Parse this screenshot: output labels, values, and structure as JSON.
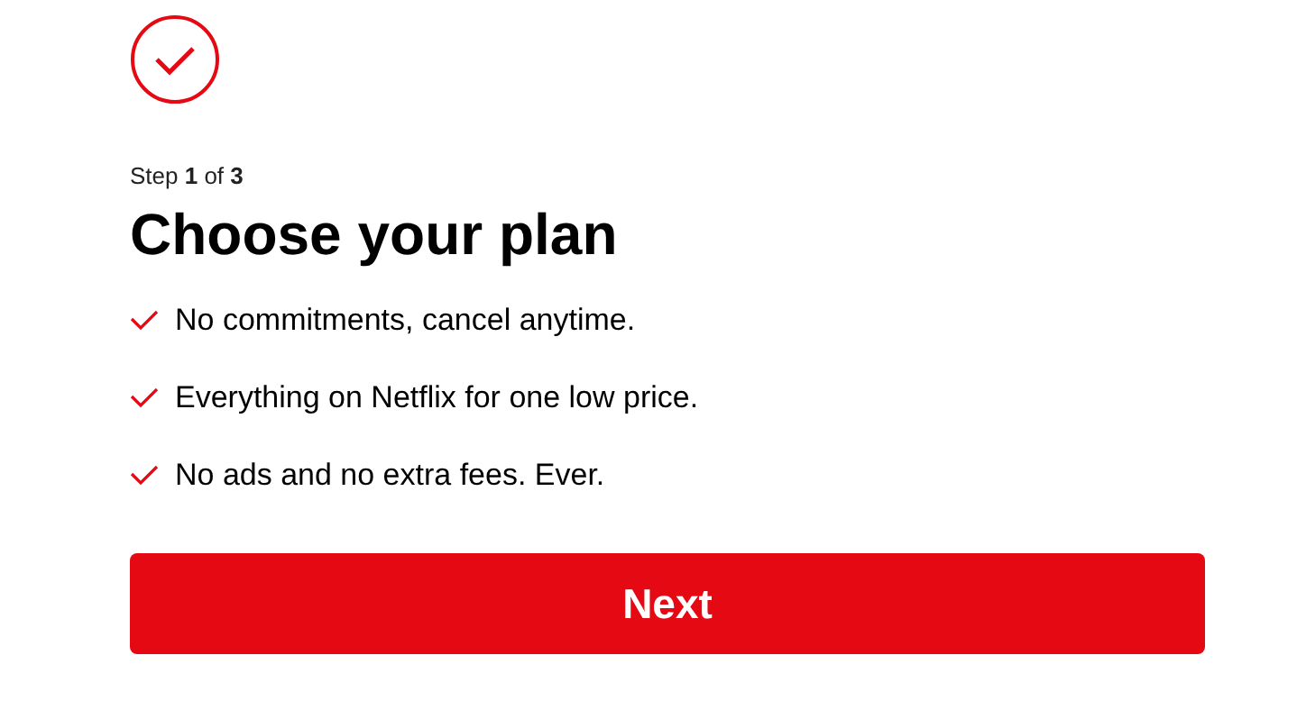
{
  "step": "Step **1** of **3**",
  "title": "Choose your plan",
  "benefits": [
    {
      "text": "No commitments, cancel anytime."
    },
    {
      "text": "Everything on Netflix for one low price."
    },
    {
      "text": "No ads and no extra fees. Ever."
    }
  ],
  "button": {
    "label": "Next"
  }
}
